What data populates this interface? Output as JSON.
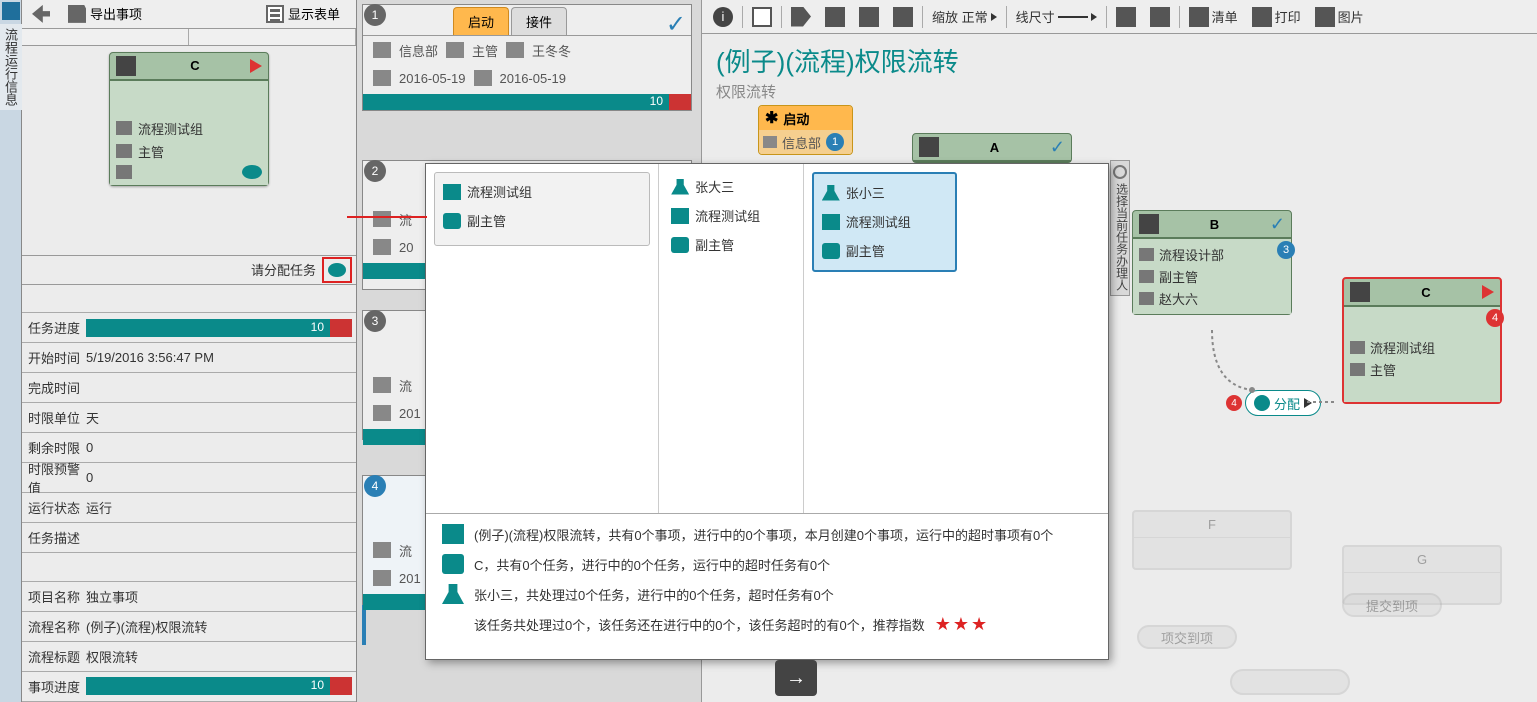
{
  "vbar_label": "流程运行信息",
  "leftToolbar": {
    "export": "导出事项",
    "showForm": "显示表单"
  },
  "leftCard": {
    "title": "C",
    "group": "流程测试组",
    "role": "主管"
  },
  "assign_label": "请分配任务",
  "metrics": {
    "progress_k": "任务进度",
    "progress_v": "10",
    "start_k": "开始时间",
    "start_v": "5/19/2016 3:56:47 PM",
    "end_k": "完成时间",
    "end_v": "",
    "unit_k": "时限单位",
    "unit_v": "天",
    "remain_k": "剩余时限",
    "remain_v": "0",
    "warn_k": "时限预警值",
    "warn_v": "0",
    "state_k": "运行状态",
    "state_v": "运行",
    "desc_k": "任务描述",
    "desc_v": ""
  },
  "proj": {
    "name_k": "项目名称",
    "name_v": "独立事项",
    "flow_k": "流程名称",
    "flow_v": "(例子)(流程)权限流转",
    "title_k": "流程标题",
    "title_v": "权限流转",
    "prog_k": "事项进度",
    "prog_v": "10"
  },
  "steps": {
    "s1": {
      "tab1": "启动",
      "tab2": "接件",
      "dept": "信息部",
      "role": "主管",
      "user": "王冬冬",
      "d1": "2016-05-19",
      "d2": "2016-05-19",
      "bar": "10"
    },
    "s2": {
      "prefix": "流",
      "date": "20"
    },
    "s3": {
      "prefix": "流",
      "date": "201"
    },
    "s4": {
      "prefix": "流",
      "date": "201"
    }
  },
  "rToolbar": {
    "zoom": "缩放 正常",
    "line": "线尺寸",
    "list": "清单",
    "print": "打印",
    "img": "图片"
  },
  "rTitle": {
    "main": "(例子)(流程)权限流转",
    "sub": "权限流转"
  },
  "startNode": {
    "title": "启动",
    "dept": "信息部",
    "badge": "1"
  },
  "nodeA": {
    "title": "A"
  },
  "nodeB": {
    "title": "B",
    "badge": "3",
    "dept": "流程设计部",
    "role": "副主管",
    "user": "赵大六"
  },
  "nodeC": {
    "title": "C",
    "badge": "4",
    "group": "流程测试组",
    "role": "主管"
  },
  "alloc": {
    "label": "分配",
    "badge": "4"
  },
  "vside": "选择当前任务办理人",
  "faded": {
    "f": "F",
    "g": "G",
    "lbl1": "项交到项",
    "lbl2": "提交到项"
  },
  "popup": {
    "col1": {
      "a": "流程测试组",
      "b": "副主管"
    },
    "col2": {
      "a": "张大三",
      "b": "流程测试组",
      "c": "副主管"
    },
    "col3": {
      "a": "张小三",
      "b": "流程测试组",
      "c": "副主管"
    },
    "s1": "(例子)(流程)权限流转，共有0个事项，进行中的0个事项，本月创建0个事项，运行中的超时事项有0个",
    "s2": "C，共有0个任务，进行中的0个任务，运行中的超时任务有0个",
    "s3": "张小三，共处理过0个任务，进行中的0个任务，超时任务有0个",
    "s4a": "该任务共处理过0个，该任务还在进行中的0个，该任务超时的有0个，推荐指数",
    "stars": "★★★"
  }
}
